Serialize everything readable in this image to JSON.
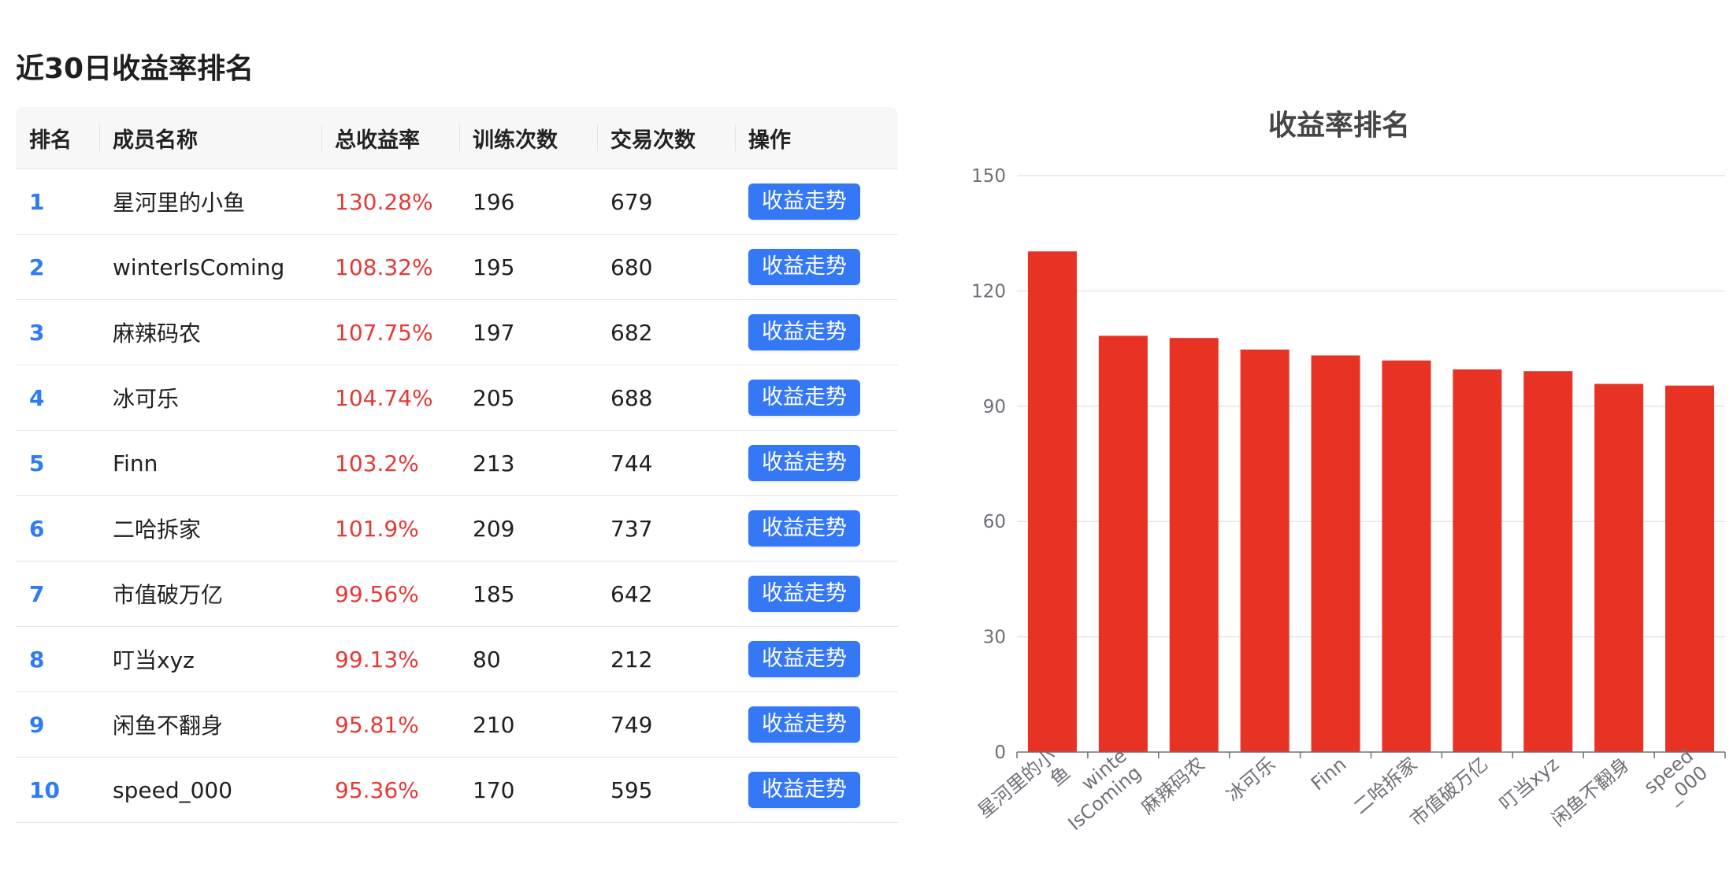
{
  "page_title": "近30日收益率排名",
  "table": {
    "headers": [
      "排名",
      "成员名称",
      "总收益率",
      "训练次数",
      "交易次数",
      "操作"
    ],
    "rows": [
      {
        "rank": "1",
        "name": "星河里的小鱼",
        "total_return": "130.28%",
        "train_count": "196",
        "trade_count": "679",
        "action": "收益走势"
      },
      {
        "rank": "2",
        "name": "winterIsComing",
        "total_return": "108.32%",
        "train_count": "195",
        "trade_count": "680",
        "action": "收益走势"
      },
      {
        "rank": "3",
        "name": "麻辣码农",
        "total_return": "107.75%",
        "train_count": "197",
        "trade_count": "682",
        "action": "收益走势"
      },
      {
        "rank": "4",
        "name": "冰可乐",
        "total_return": "104.74%",
        "train_count": "205",
        "trade_count": "688",
        "action": "收益走势"
      },
      {
        "rank": "5",
        "name": "Finn",
        "total_return": "103.2%",
        "train_count": "213",
        "trade_count": "744",
        "action": "收益走势"
      },
      {
        "rank": "6",
        "name": "二哈拆家",
        "total_return": "101.9%",
        "train_count": "209",
        "trade_count": "737",
        "action": "收益走势"
      },
      {
        "rank": "7",
        "name": "市值破万亿",
        "total_return": "99.56%",
        "train_count": "185",
        "trade_count": "642",
        "action": "收益走势"
      },
      {
        "rank": "8",
        "name": "叮当xyz",
        "total_return": "99.13%",
        "train_count": "80",
        "trade_count": "212",
        "action": "收益走势"
      },
      {
        "rank": "9",
        "name": "闲鱼不翻身",
        "total_return": "95.81%",
        "train_count": "210",
        "trade_count": "749",
        "action": "收益走势"
      },
      {
        "rank": "10",
        "name": "speed_000",
        "total_return": "95.36%",
        "train_count": "170",
        "trade_count": "595",
        "action": "收益走势"
      }
    ]
  },
  "colors": {
    "rank_text": "#2f7cf0",
    "return_text": "#e53935",
    "button_bg": "#3478f6",
    "bar": "#e83324"
  },
  "chart_data": {
    "type": "bar",
    "title": "收益率排名",
    "categories": [
      "星河里的小鱼",
      "winterIsComing",
      "麻辣码农",
      "冰可乐",
      "Finn",
      "二哈拆家",
      "市值破万亿",
      "叮当xyz",
      "闲鱼不翻身",
      "speed_000"
    ],
    "category_labels": [
      [
        "星河里的小",
        "鱼"
      ],
      [
        "winte",
        "IsComing"
      ],
      [
        "麻辣码农"
      ],
      [
        "冰可乐"
      ],
      [
        "Finn"
      ],
      [
        "二哈拆家"
      ],
      [
        "市值破万亿"
      ],
      [
        "叮当xyz"
      ],
      [
        "闲鱼不翻身"
      ],
      [
        "speed",
        "_000"
      ]
    ],
    "values": [
      130.28,
      108.32,
      107.75,
      104.74,
      103.2,
      101.9,
      99.56,
      99.13,
      95.81,
      95.36
    ],
    "yticks": [
      0,
      30,
      60,
      90,
      120,
      150
    ],
    "ylim": [
      0,
      150
    ],
    "xlabel": "",
    "ylabel": "",
    "grid": true,
    "legend": "none"
  }
}
